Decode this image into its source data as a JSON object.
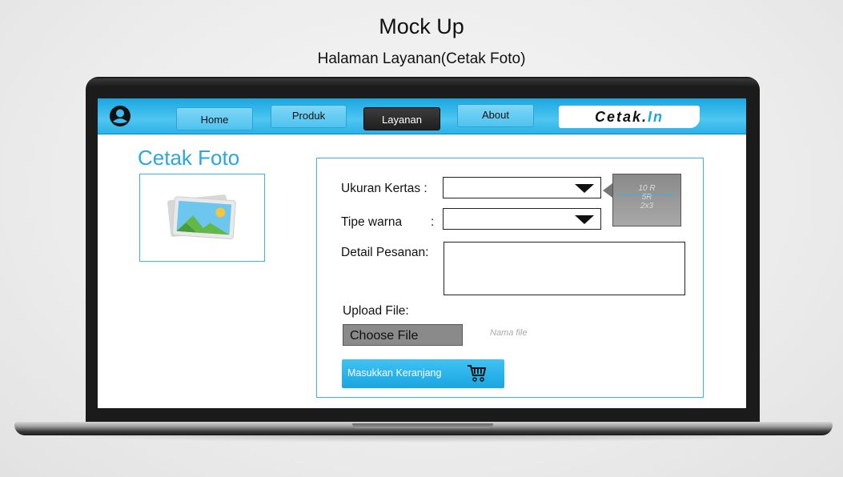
{
  "header": {
    "title": "Mock Up",
    "subtitle": "Halaman Layanan(Cetak Foto)"
  },
  "nav": {
    "home": "Home",
    "produk": "Produk",
    "layanan": "Layanan",
    "about": "About",
    "brand_main": "Cetak.",
    "brand_accent": "In",
    "active_item": "Layanan"
  },
  "page": {
    "title": "Cetak Foto"
  },
  "form": {
    "ukuran_label": "Ukuran Kertas :",
    "ukuran_value": "",
    "ukuran_options": [
      "10 R",
      "5R",
      "2x3"
    ],
    "tipe_label": "Tipe warna",
    "tipe_colon": ":",
    "tipe_value": "",
    "detail_label": "Detail Pesanan:",
    "detail_value": "",
    "upload_label": "Upload File:",
    "choose_file": "Choose File",
    "file_name": "Nama file",
    "cart_button": "Masukkan Keranjang"
  },
  "colors": {
    "accent": "#2aa7e0",
    "nav_active": "#2a2a2a",
    "laptop": "#1b1b1b"
  },
  "icons": {
    "avatar": "user-avatar-icon",
    "image": "photo-gallery-icon",
    "cart": "shopping-cart-icon"
  }
}
